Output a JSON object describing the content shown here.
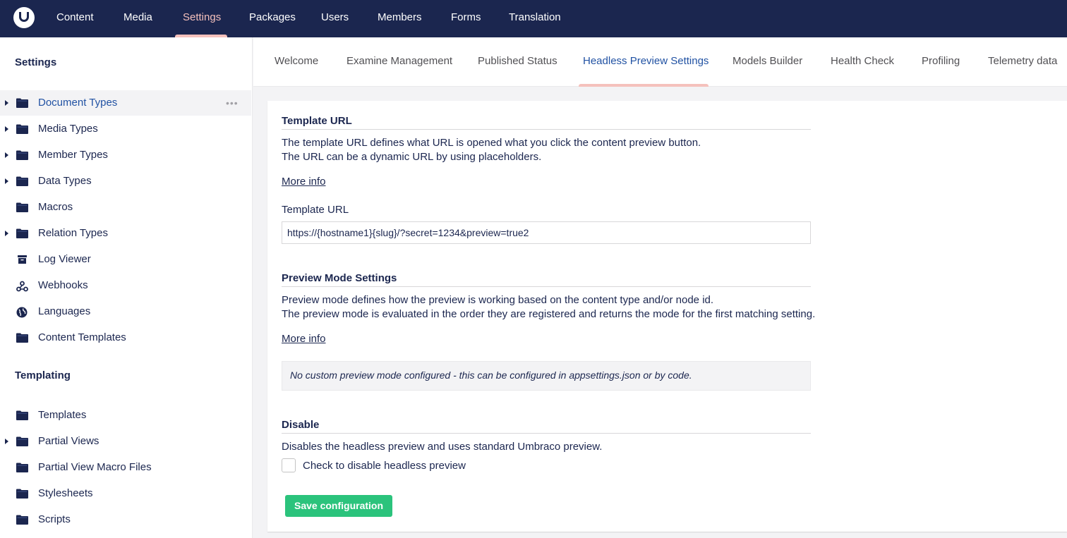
{
  "topnav": {
    "items": [
      {
        "label": "Content"
      },
      {
        "label": "Media"
      },
      {
        "label": "Settings",
        "active": true
      },
      {
        "label": "Packages"
      },
      {
        "label": "Users"
      },
      {
        "label": "Members"
      },
      {
        "label": "Forms"
      },
      {
        "label": "Translation"
      }
    ]
  },
  "sidebar": {
    "settings_title": "Settings",
    "settings_items": [
      {
        "label": "Document Types",
        "icon": "folder-icon",
        "expandable": true,
        "active": true
      },
      {
        "label": "Media Types",
        "icon": "folder-icon",
        "expandable": true
      },
      {
        "label": "Member Types",
        "icon": "folder-icon",
        "expandable": true
      },
      {
        "label": "Data Types",
        "icon": "folder-icon",
        "expandable": true
      },
      {
        "label": "Macros",
        "icon": "folder-icon",
        "expandable": false
      },
      {
        "label": "Relation Types",
        "icon": "folder-icon",
        "expandable": true
      },
      {
        "label": "Log Viewer",
        "icon": "box-icon",
        "expandable": false
      },
      {
        "label": "Webhooks",
        "icon": "webhook-icon",
        "expandable": false
      },
      {
        "label": "Languages",
        "icon": "globe-icon",
        "expandable": false
      },
      {
        "label": "Content Templates",
        "icon": "folder-icon",
        "expandable": false
      }
    ],
    "templating_title": "Templating",
    "templating_items": [
      {
        "label": "Templates",
        "icon": "folder-icon",
        "expandable": false
      },
      {
        "label": "Partial Views",
        "icon": "folder-icon",
        "expandable": true
      },
      {
        "label": "Partial View Macro Files",
        "icon": "folder-icon",
        "expandable": false
      },
      {
        "label": "Stylesheets",
        "icon": "folder-icon",
        "expandable": false
      },
      {
        "label": "Scripts",
        "icon": "folder-icon",
        "expandable": false
      }
    ],
    "more_glyph": "•••"
  },
  "tabs": [
    {
      "label": "Welcome"
    },
    {
      "label": "Examine Management"
    },
    {
      "label": "Published Status"
    },
    {
      "label": "Headless Preview Settings",
      "active": true
    },
    {
      "label": "Models Builder"
    },
    {
      "label": "Health Check"
    },
    {
      "label": "Profiling"
    },
    {
      "label": "Telemetry data"
    }
  ],
  "template_url": {
    "heading": "Template URL",
    "desc_line1": "The template URL defines what URL is opened what you click the content preview button.",
    "desc_line2": "The URL can be a dynamic URL by using placeholders.",
    "more_info": "More info",
    "field_label": "Template URL",
    "field_value": "https://{hostname1}{slug}/?secret=1234&preview=true2"
  },
  "preview_mode": {
    "heading": "Preview Mode Settings",
    "desc_line1": "Preview mode defines how the preview is working based on the content type and/or node id.",
    "desc_line2": "The preview mode is evaluated in the order they are registered and returns the mode for the first matching setting.",
    "more_info": "More info",
    "notice": "No custom preview mode configured - this can be configured in appsettings.json or by code."
  },
  "disable": {
    "heading": "Disable",
    "desc": "Disables the headless preview and uses standard Umbraco preview.",
    "checkbox_label": "Check to disable headless preview",
    "checked": false
  },
  "save_button": "Save configuration",
  "colors": {
    "topbar": "#1b264f",
    "active_nav": "#f5c1bc",
    "active_text": "#2152a3",
    "save_button": "#2bc37c"
  }
}
